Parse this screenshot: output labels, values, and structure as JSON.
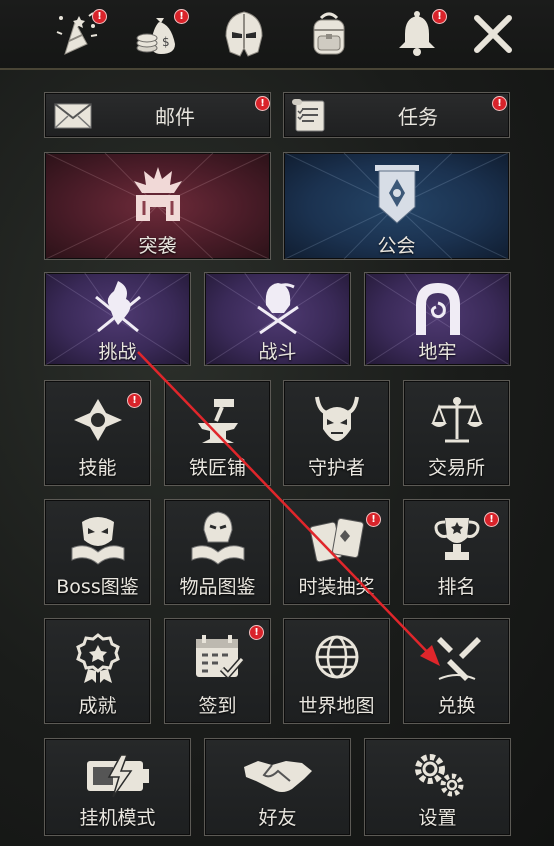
{
  "top_icons": [
    {
      "name": "celebration-icon",
      "badge": true
    },
    {
      "name": "money-bag-icon",
      "badge": true
    },
    {
      "name": "helmet-icon",
      "badge": false
    },
    {
      "name": "backpack-icon",
      "badge": false
    },
    {
      "name": "bell-icon",
      "badge": true
    },
    {
      "name": "close-icon",
      "badge": false
    }
  ],
  "wide_buttons": {
    "mail": {
      "label": "邮件",
      "badge": true
    },
    "quest": {
      "label": "任务",
      "badge": true
    }
  },
  "big_buttons": {
    "raid": {
      "label": "突袭"
    },
    "guild": {
      "label": "公会"
    }
  },
  "mid_buttons": {
    "challenge": {
      "label": "挑战"
    },
    "battle": {
      "label": "战斗"
    },
    "dungeon": {
      "label": "地牢"
    }
  },
  "tiles": {
    "skills": {
      "label": "技能",
      "badge": true
    },
    "blacksmith": {
      "label": "铁匠铺",
      "badge": false
    },
    "guardian": {
      "label": "守护者",
      "badge": false
    },
    "exchange_house": {
      "label": "交易所",
      "badge": false
    },
    "boss_codex": {
      "label": "Boss图鉴",
      "badge": false
    },
    "item_codex": {
      "label": "物品图鉴",
      "badge": false
    },
    "costume_draw": {
      "label": "时装抽奖",
      "badge": true
    },
    "ranking": {
      "label": "排名",
      "badge": true
    },
    "achievement": {
      "label": "成就",
      "badge": false
    },
    "checkin": {
      "label": "签到",
      "badge": true
    },
    "world_map": {
      "label": "世界地图",
      "badge": false
    },
    "redeem": {
      "label": "兑换",
      "badge": false
    }
  },
  "bottom_buttons": {
    "idle_mode": {
      "label": "挂机模式"
    },
    "friends": {
      "label": "好友"
    },
    "settings": {
      "label": "设置"
    }
  },
  "badge_text": "!",
  "colors": {
    "badge": "#d9232a",
    "annotation_arrow": "#e0262b"
  }
}
